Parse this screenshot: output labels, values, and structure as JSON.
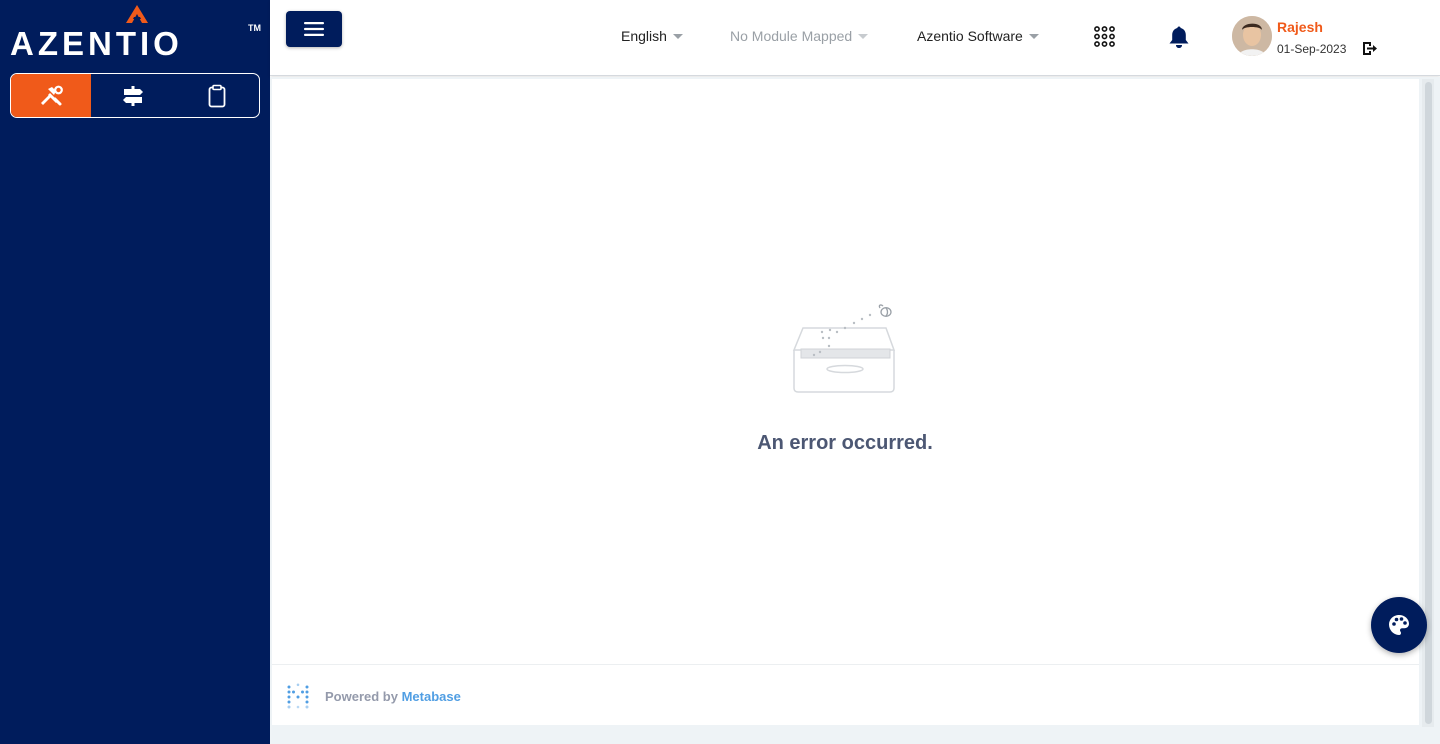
{
  "brand": {
    "name": "AZENTIO",
    "trademark": "TM"
  },
  "sidebar": {
    "tabs": [
      {
        "icon": "tools-icon",
        "active": true
      },
      {
        "icon": "signpost-icon",
        "active": false
      },
      {
        "icon": "clipboard-icon",
        "active": false
      }
    ]
  },
  "header": {
    "language": "English",
    "module": "No Module Mapped",
    "company": "Azentio Software",
    "user": {
      "name": "Rajesh",
      "date": "01-Sep-2023"
    }
  },
  "main": {
    "error_message": "An error occurred."
  },
  "footer": {
    "powered_by": "Powered by ",
    "brand": "Metabase"
  },
  "colors": {
    "sidebar": "#001c5c",
    "accent": "#f05a1a",
    "error_text": "#4c5773",
    "metabase_blue": "#509ee3"
  }
}
